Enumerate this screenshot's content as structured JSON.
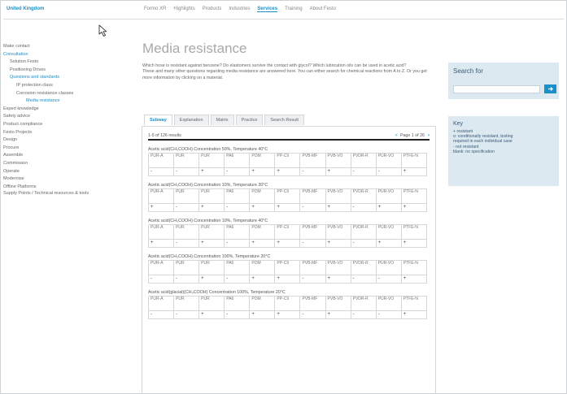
{
  "header": {
    "country": "United Kingdom",
    "nav": [
      "Formo XR",
      "Highlights",
      "Products",
      "Industries",
      "Services",
      "Training",
      "About Festo"
    ],
    "active_nav_index": 4
  },
  "sidebar": {
    "items": [
      {
        "label": "Make contact",
        "level": 0,
        "blue": false
      },
      {
        "label": "Consultation",
        "level": 0,
        "blue": true
      },
      {
        "label": "Solution Festo",
        "level": 1,
        "blue": false
      },
      {
        "label": "Positioning Drives",
        "level": 1,
        "blue": false
      },
      {
        "label": "Questions and standards",
        "level": 1,
        "blue": true
      },
      {
        "label": "IP protection class",
        "level": 2,
        "blue": false
      },
      {
        "label": "Corrosion resistance classes",
        "level": 2,
        "blue": false
      },
      {
        "label": "Media resistance",
        "level": 3,
        "blue": true
      },
      {
        "label": "Expert knowledge",
        "level": 0,
        "blue": false
      },
      {
        "label": "Safety advice",
        "level": 0,
        "blue": false
      },
      {
        "label": "Product compliance",
        "level": 0,
        "blue": false
      },
      {
        "label": "Festo Projects",
        "level": 0,
        "blue": false
      },
      {
        "label": "Design",
        "level": 0,
        "blue": false
      },
      {
        "label": "Procure",
        "level": 0,
        "blue": false
      },
      {
        "label": "Assemble",
        "level": 0,
        "blue": false
      },
      {
        "label": "Commission",
        "level": 0,
        "blue": false
      },
      {
        "label": "Operate",
        "level": 0,
        "blue": false
      },
      {
        "label": "Modernise",
        "level": 0,
        "blue": false
      },
      {
        "label": "Offline Platforms",
        "level": 0,
        "blue": false
      },
      {
        "label": "Supply Points / Technical resources & tools",
        "level": 0,
        "blue": false
      }
    ]
  },
  "main": {
    "title": "Media resistance",
    "intro": [
      "Which hose is resistant against benzene? Do elastomers survive the contact with glycol? Which lubrication oils can be used in acetic acid?",
      "These and many other questions regarding media resistance are answered here. You can either search for chemical reactions from A to Z. Or you get more information by clicking on a material."
    ],
    "tabs": [
      "Subway",
      "Explanation",
      "Matrix",
      "Practice",
      "Search Result"
    ],
    "active_tab_index": 0,
    "results_text": "1-5 of 126 results",
    "pager": {
      "prev": "‹",
      "text": "Page 1 of 26",
      "next": "›"
    },
    "columns": [
      "PUR-A",
      "PUR",
      "PUR",
      "PA6",
      "POM",
      "PP-C9",
      "PVB-MF",
      "PVB-VO",
      "PVDR-R",
      "PUR-VO",
      "PTFE-N"
    ],
    "groups": [
      {
        "title": "Acetic acid(CH₃COOH) Concentration 50%, Temperature 40°C",
        "values": [
          "-",
          "-",
          "+",
          "-",
          "+",
          "+",
          "-",
          "+",
          "-",
          "-",
          "+"
        ]
      },
      {
        "title": "Acetic acid(CH₃COOH) Concentration 10%, Temperature 30°C",
        "values": [
          "+",
          "-",
          "+",
          "-",
          "+",
          "+",
          "-",
          "+",
          "-",
          "+",
          "+"
        ]
      },
      {
        "title": "Acetic acid(CH₃COOH) Concentration 10%, Temperature 40°C",
        "values": [
          "+",
          "-",
          "+",
          "-",
          "+",
          "+",
          "-",
          "+",
          "-",
          "+",
          "+"
        ]
      },
      {
        "title": "Acetic acid(CH₃COOH) Concentration 100%, Temperature 20°C",
        "values": [
          "-",
          "-",
          "+",
          "-",
          "+",
          "+",
          "-",
          "+",
          "-",
          "-",
          "+"
        ]
      },
      {
        "title": "Acetic acid(glacial)(CH₃COOH) Concentration 100%, Temperature 20°C",
        "values": [
          "-",
          "-",
          "+",
          "-",
          "+",
          "+",
          "-",
          "+",
          "-",
          "-",
          "+"
        ]
      }
    ]
  },
  "search": {
    "title": "Search for",
    "placeholder": ""
  },
  "key": {
    "title": "Key",
    "lines": [
      "+ resistant",
      "o: conditionally resistant, testing",
      "required in each individual case",
      "- not resistant",
      "blank: no specification"
    ]
  },
  "colors": {
    "accent": "#1a8fc9",
    "panel": "#dde9f1"
  },
  "icons": {
    "cursor": "mouse-cursor-icon",
    "search": "search-icon"
  }
}
